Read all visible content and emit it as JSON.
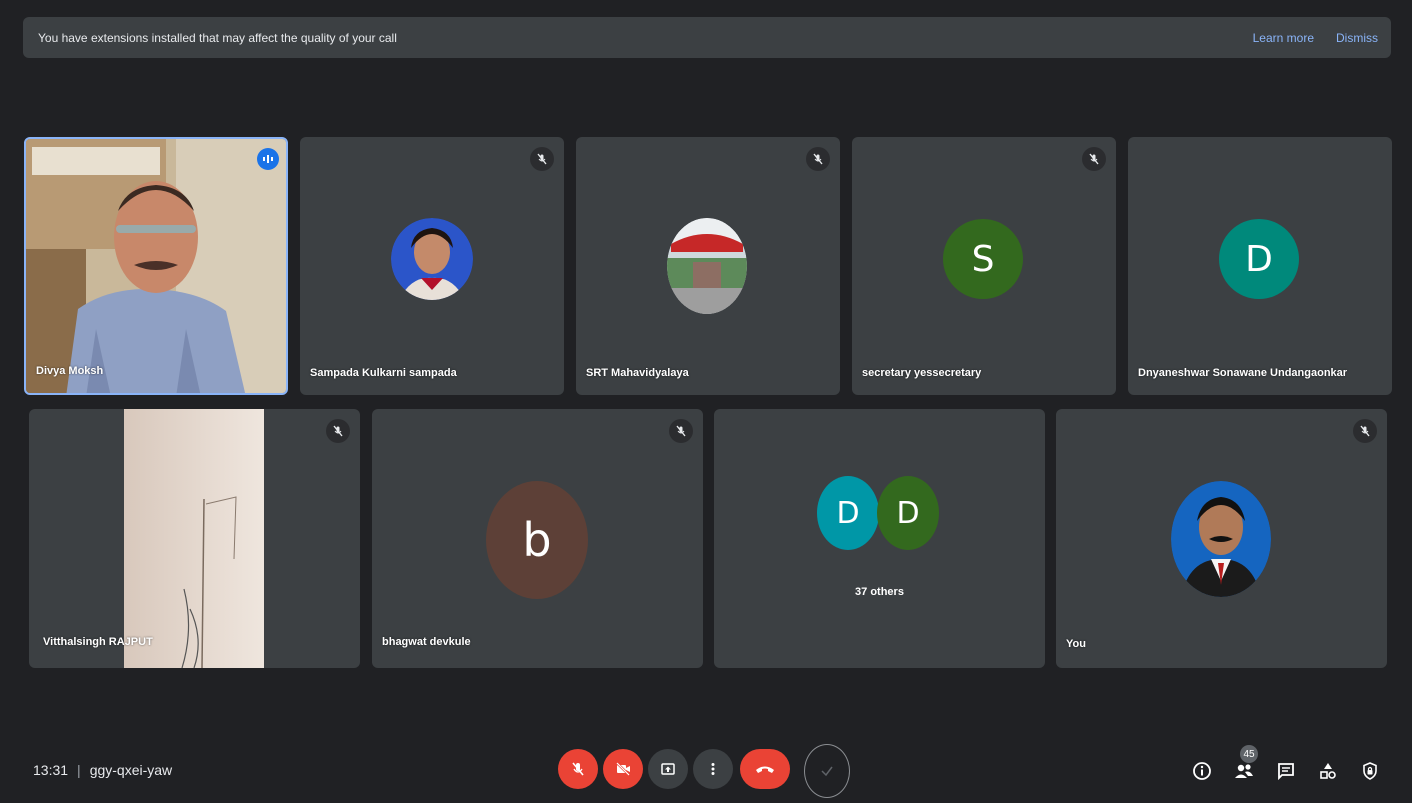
{
  "banner": {
    "message": "You have extensions installed that may affect the quality of your call",
    "learn_more": "Learn more",
    "dismiss": "Dismiss"
  },
  "participants": [
    {
      "name": "Divya Moksh",
      "speaking": true
    },
    {
      "name": "Sampada Kulkarni sampada",
      "muted": true
    },
    {
      "name": "SRT Mahavidyalaya",
      "muted": true
    },
    {
      "name": "secretary yessecretary",
      "muted": true,
      "initial": "S",
      "color": "#33691e"
    },
    {
      "name": "Dnyaneshwar Sonawane Undangaonkar",
      "initial": "D",
      "color": "#00897b"
    },
    {
      "name": "Vitthalsingh RAJPUT",
      "muted": true
    },
    {
      "name": "bhagwat devkule",
      "muted": true,
      "initial": "b",
      "color": "#5d4037"
    },
    {
      "others_label": "37 others",
      "initial_a": "D",
      "color_a": "#0097a7",
      "initial_b": "D",
      "color_b": "#33691e"
    },
    {
      "name": "You",
      "muted": true
    }
  ],
  "footer": {
    "time": "13:31",
    "separator": "|",
    "meeting_code": "ggy-qxei-yaw",
    "participant_count": "45"
  },
  "colors": {
    "background": "#202124",
    "tile": "#3c4043",
    "danger": "#ea4335",
    "accent": "#8ab4f8",
    "speaking": "#1a73e8"
  }
}
